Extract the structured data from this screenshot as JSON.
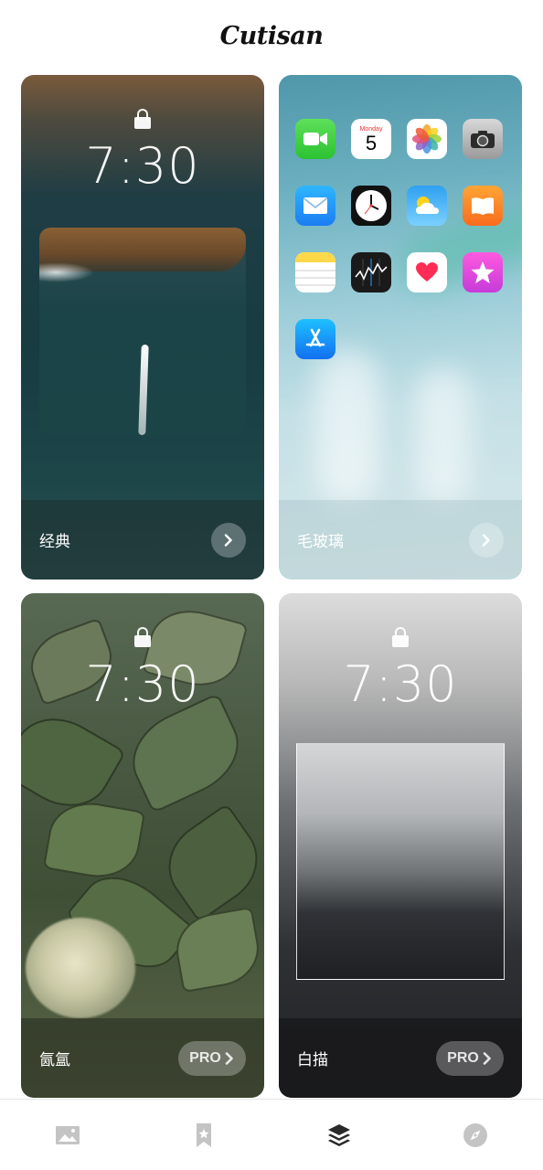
{
  "app": {
    "logo": "Cutisan"
  },
  "cards": [
    {
      "name": "经典",
      "clock": "7:30",
      "action": "chevron"
    },
    {
      "name": "毛玻璃",
      "action": "chevron"
    },
    {
      "name": "氤氲",
      "clock": "7:30",
      "action": "pro",
      "badge": "PRO"
    },
    {
      "name": "白描",
      "clock": "7:30",
      "action": "pro",
      "badge": "PRO"
    }
  ],
  "calendar_icon": {
    "weekday": "Monday",
    "day": "5"
  },
  "tabs": [
    {
      "icon": "image-icon",
      "active": false
    },
    {
      "icon": "bookmark-star-icon",
      "active": false
    },
    {
      "icon": "layers-icon",
      "active": true
    },
    {
      "icon": "compass-icon",
      "active": false
    }
  ],
  "colors": {
    "tab_inactive": "#c4c4c4",
    "tab_active": "#2a2a2a"
  }
}
